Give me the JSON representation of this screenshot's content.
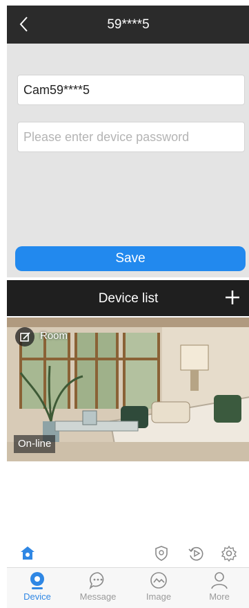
{
  "edit_screen": {
    "title": "59****5",
    "device_name_value": "Cam59****5",
    "password_placeholder": "Please enter device password",
    "save_label": "Save"
  },
  "device_list": {
    "title": "Device list",
    "device": {
      "name": "Room",
      "status": "On-line"
    },
    "quick_actions": [
      "home-shield-icon",
      "shield-icon",
      "playback-icon",
      "gear-icon"
    ]
  },
  "tabs": [
    {
      "label": "Device",
      "icon": "device-icon",
      "active": true
    },
    {
      "label": "Message",
      "icon": "message-icon",
      "active": false
    },
    {
      "label": "Image",
      "icon": "image-icon",
      "active": false
    },
    {
      "label": "More",
      "icon": "person-icon",
      "active": false
    }
  ],
  "colors": {
    "accent": "#2289ee",
    "tab_active": "#2f87e4",
    "header": "#2b2b2b"
  }
}
